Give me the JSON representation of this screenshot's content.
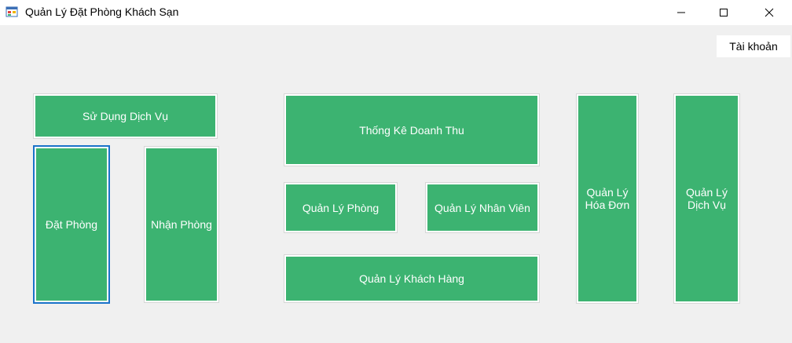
{
  "window": {
    "title": "Quản Lý Đặt Phòng Khách Sạn",
    "icon": "app-form-icon",
    "controls": {
      "minimize": "minimize-icon",
      "maximize": "maximize-icon",
      "close": "close-icon"
    }
  },
  "header": {
    "account_label": "Tài khoản"
  },
  "tiles": {
    "su_dung_dich_vu": "Sử Dụng Dịch Vụ",
    "dat_phong": "Đặt Phòng",
    "nhan_phong": "Nhận Phòng",
    "thong_ke_doanh_thu": "Thống Kê Doanh Thu",
    "quan_ly_phong": "Quản Lý Phòng",
    "quan_ly_nhan_vien": "Quản Lý Nhân Viên",
    "quan_ly_khach_hang": "Quản Lý Khách Hàng",
    "quan_ly_hoa_don": "Quản Lý\nHóa Đơn",
    "quan_ly_dich_vu": "Quản Lý\nDịch Vụ"
  },
  "colors": {
    "tile_background": "#3cb371",
    "tile_text": "#ffffff",
    "focus_border": "#1a73c9",
    "window_background": "#f0f0f0"
  }
}
